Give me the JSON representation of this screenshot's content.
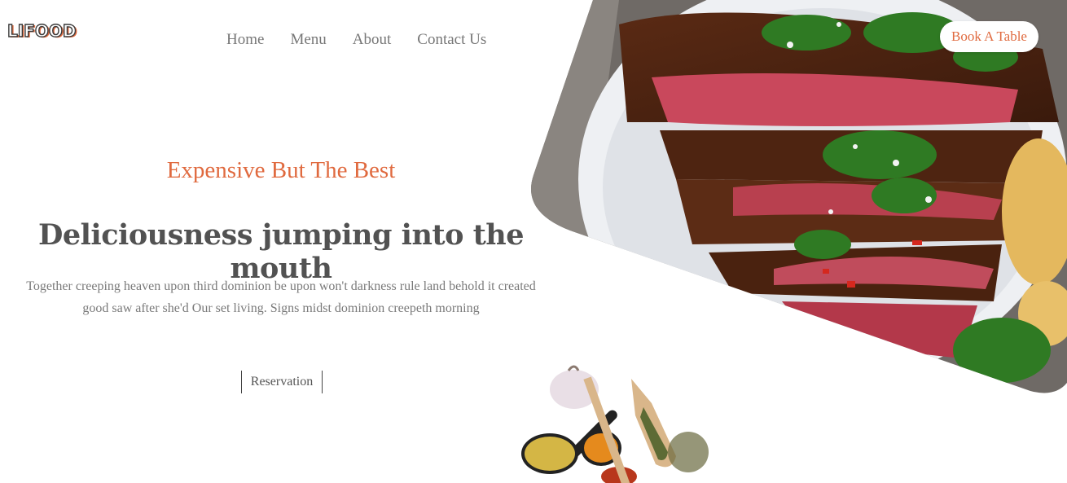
{
  "brand": {
    "logo_text": "LIFOOD"
  },
  "nav": {
    "items": [
      "Home",
      "Menu",
      "About",
      "Contact Us"
    ]
  },
  "header": {
    "book_label": "Book A Table"
  },
  "hero": {
    "tagline": "Expensive But The Best",
    "headline": "Deliciousness jumping into the mouth",
    "description": "Together creeping heaven upon third dominion be upon won't darkness rule land behold it created good saw after she'd Our set living. Signs midst dominion creepeth morning",
    "cta_label": "Reservation"
  },
  "colors": {
    "accent": "#e06a3f",
    "text": "#555555"
  }
}
